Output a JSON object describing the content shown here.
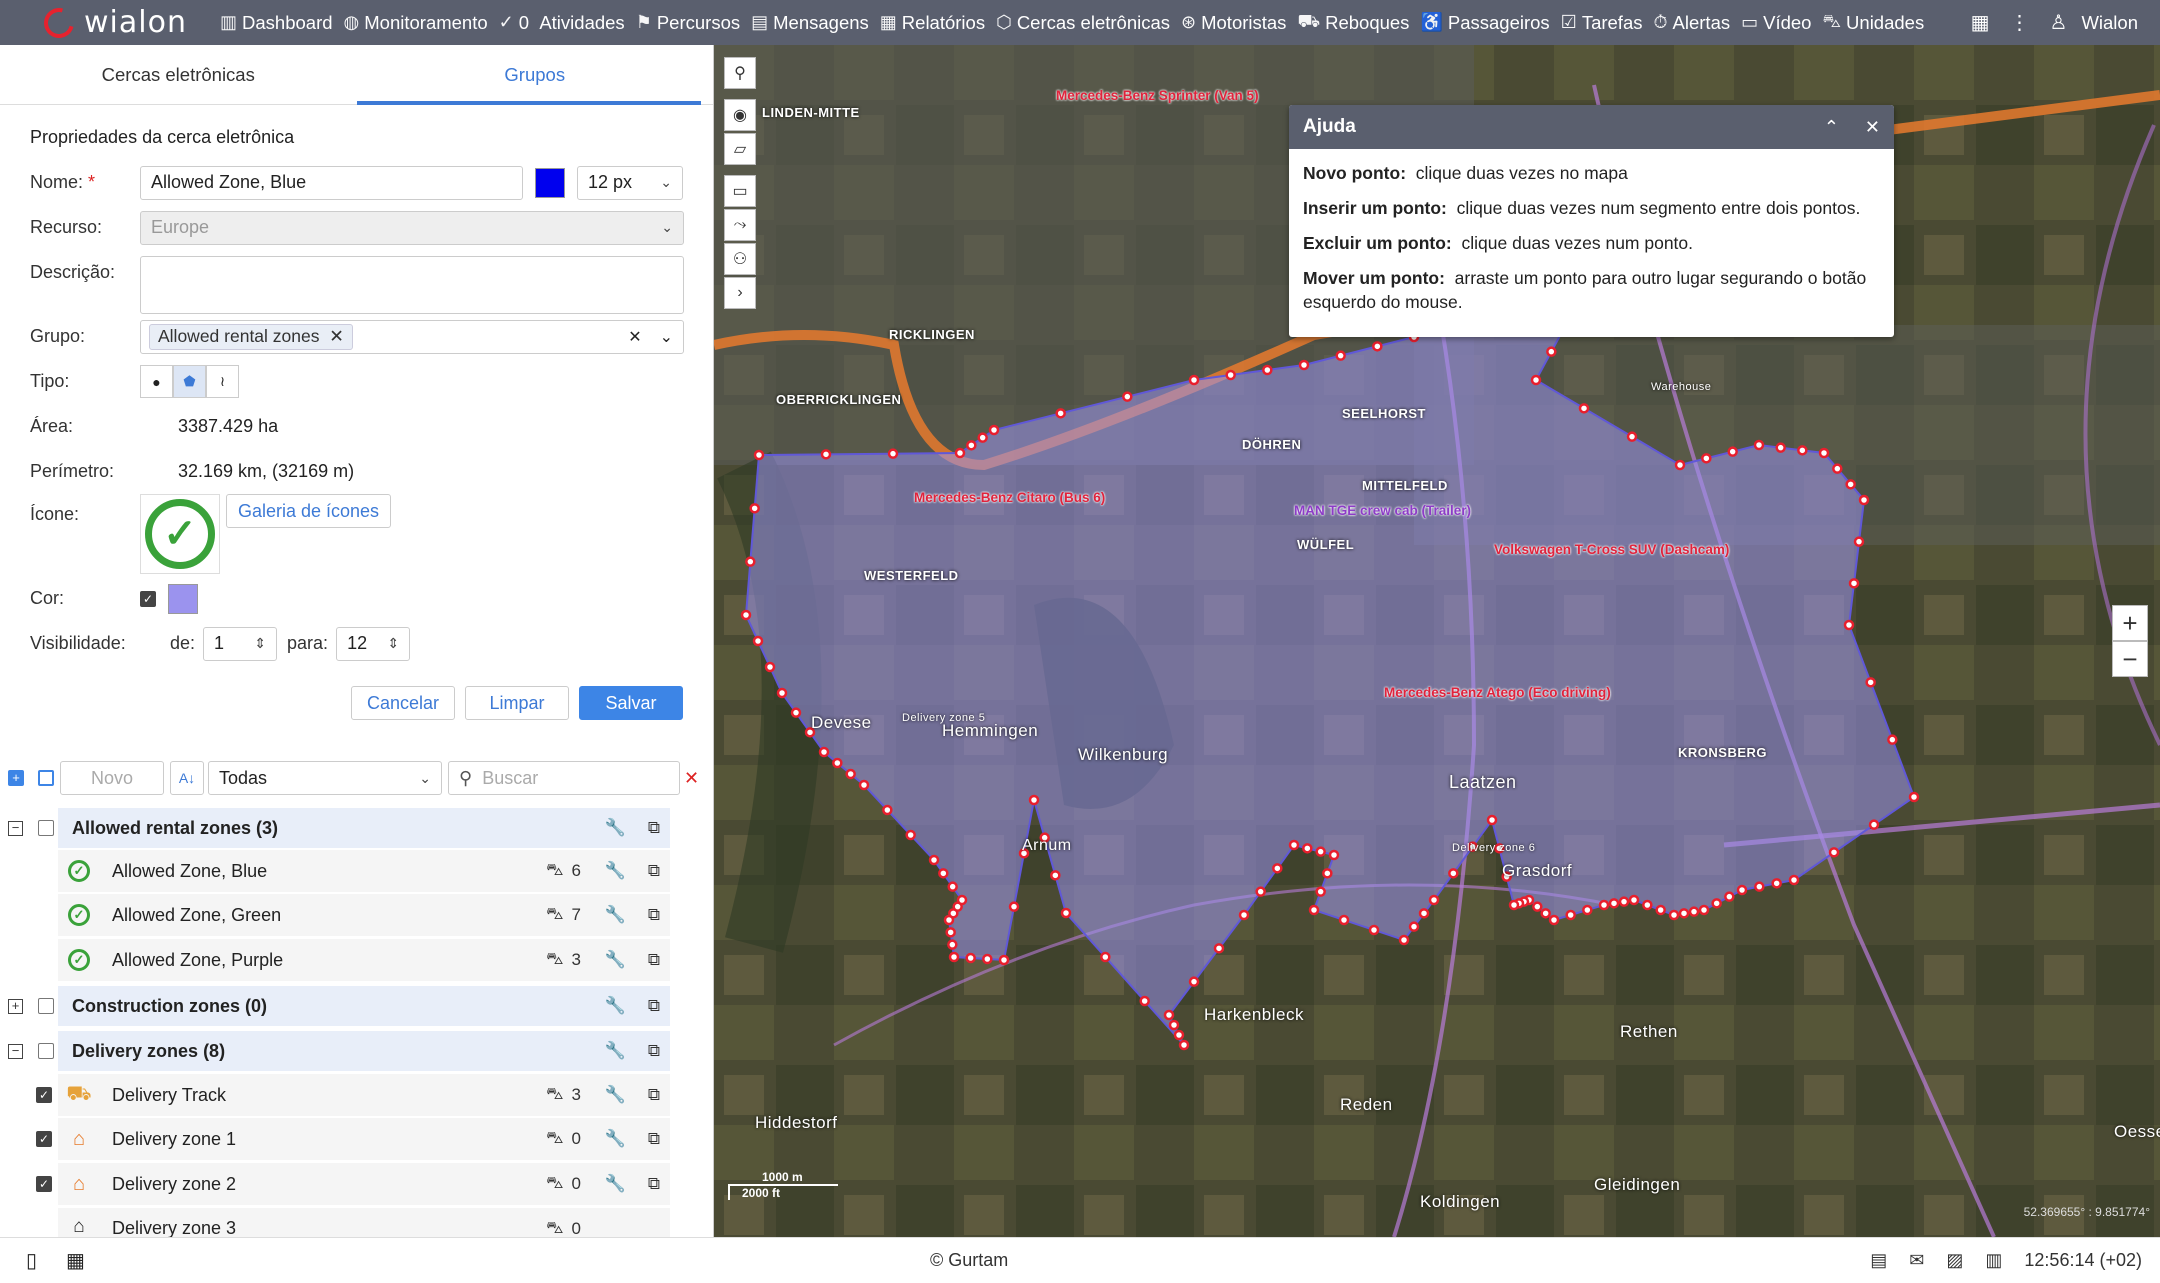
{
  "app": {
    "brand": "wialon",
    "user": "Wialon"
  },
  "nav": [
    {
      "label": "Dashboard",
      "icon": "chart-icon"
    },
    {
      "label": "Monitoramento",
      "icon": "globe-icon"
    },
    {
      "label": "0",
      "icon": "check-circle-icon"
    },
    {
      "label": "Atividades",
      "icon": ""
    },
    {
      "label": "Percursos",
      "icon": "flag-icon"
    },
    {
      "label": "Mensagens",
      "icon": "messages-icon"
    },
    {
      "label": "Relatórios",
      "icon": "report-icon"
    },
    {
      "label": "Cercas eletrônicas",
      "icon": "geofence-icon"
    },
    {
      "label": "Motoristas",
      "icon": "wheel-icon"
    },
    {
      "label": "Reboques",
      "icon": "trailer-icon"
    },
    {
      "label": "Passageiros",
      "icon": "passenger-icon"
    },
    {
      "label": "Tarefas",
      "icon": "task-icon"
    },
    {
      "label": "Alertas",
      "icon": "alarm-icon"
    },
    {
      "label": "Vídeo",
      "icon": "video-icon"
    },
    {
      "label": "Unidades",
      "icon": "car-icon"
    }
  ],
  "tabs": {
    "geofences": "Cercas eletrônicas",
    "groups": "Grupos"
  },
  "form": {
    "section": "Propriedades da cerca eletrônica",
    "name_label": "Nome:",
    "name_value": "Allowed Zone, Blue",
    "name_color": "#0000ee",
    "font_size": "12 px",
    "resource_label": "Recurso:",
    "resource_value": "Europe",
    "desc_label": "Descrição:",
    "desc_value": "",
    "group_label": "Grupo:",
    "group_chip": "Allowed rental zones",
    "type_label": "Tipo:",
    "area_label": "Área:",
    "area_value": "3387.429 ha",
    "perimeter_label": "Perímetro:",
    "perimeter_value": "32.169 km, (32169 m)",
    "icon_label": "Ícone:",
    "icon_gallery": "Galeria de ícones",
    "color_label": "Cor:",
    "fill_color": "#9b93ee",
    "visibility_label": "Visibilidade:",
    "vis_from_label": "de:",
    "vis_from": "1",
    "vis_to_label": "para:",
    "vis_to": "12",
    "cancel": "Cancelar",
    "clear": "Limpar",
    "save": "Salvar"
  },
  "list_tools": {
    "new": "Novo",
    "filter": "Todas",
    "search_placeholder": "Buscar"
  },
  "groups": [
    {
      "name": "Allowed rental zones (3)",
      "expanded": true
    },
    {
      "name": "Construction zones (0)",
      "expanded": false
    },
    {
      "name": "Delivery zones (8)",
      "expanded": true
    }
  ],
  "items": [
    {
      "name": "Allowed Zone, Blue",
      "count": "6"
    },
    {
      "name": "Allowed Zone, Green",
      "count": "7"
    },
    {
      "name": "Allowed Zone, Purple",
      "count": "3"
    },
    {
      "name": "Delivery Track",
      "count": "3"
    },
    {
      "name": "Delivery zone 1",
      "count": "0"
    },
    {
      "name": "Delivery zone 2",
      "count": "0"
    },
    {
      "name": "Delivery zone 3",
      "count": "0"
    }
  ],
  "help": {
    "title": "Ajuda",
    "l1_b": "Novo ponto:",
    "l1": "clique duas vezes no mapa",
    "l2_b": "Inserir um ponto:",
    "l2": "clique duas vezes num segmento entre dois pontos.",
    "l3_b": "Excluir um ponto:",
    "l3": "clique duas vezes num ponto.",
    "l4_b": "Mover um ponto:",
    "l4": "arraste um ponto para outro lugar segurando o botão esquerdo do mouse."
  },
  "map_labels": {
    "linden": "LINDEN-MITTE",
    "ricklingen": "RICKLINGEN",
    "oberricklingen": "OBERRICKLINGEN",
    "westerfeld": "WESTERFELD",
    "seelhorst": "SEELHORST",
    "dohren": "DÖHREN",
    "mittelfeld": "MITTELFELD",
    "wulfel": "WÜLFEL",
    "kronsberg": "KRONSBERG",
    "laatzen": "Laatzen",
    "grasdorf": "Grasdorf",
    "wilkenburg": "Wilkenburg",
    "hemmingen": "Hemmingen",
    "devese": "Devese",
    "arnum": "Arnum",
    "harkenbleck": "Harkenbleck",
    "rethen": "Rethen",
    "reden": "Reden",
    "hiddestorf": "Hiddestorf",
    "koldingen": "Koldingen",
    "gleidingen": "Gleidingen",
    "oessel": "Oessel",
    "warehouse": "Warehouse",
    "dz5": "Delivery zone 5",
    "dz6": "Delivery zone 6"
  },
  "units": {
    "u1": "Mercedes-Benz Sprinter (Van 5)",
    "u2": "Mercedes-Benz Citaro (Bus 6)",
    "u3": "MAN TGE crew cab (Trailer)",
    "u4": "Volkswagen T-Cross SUV (Dashcam)",
    "u5": "Mercedes-Benz Atego (Eco driving)"
  },
  "scale": {
    "m": "1000 m",
    "ft": "2000 ft"
  },
  "coords": "52.369655° : 9.851774°",
  "status": {
    "copyright": "© Gurtam",
    "time": "12:56:14 (+02)"
  },
  "colors": {
    "accent": "#3d7ad6",
    "topbar": "#5a5f6e",
    "geofence_fill": "#9b93ee",
    "points": "#e81f2d"
  }
}
